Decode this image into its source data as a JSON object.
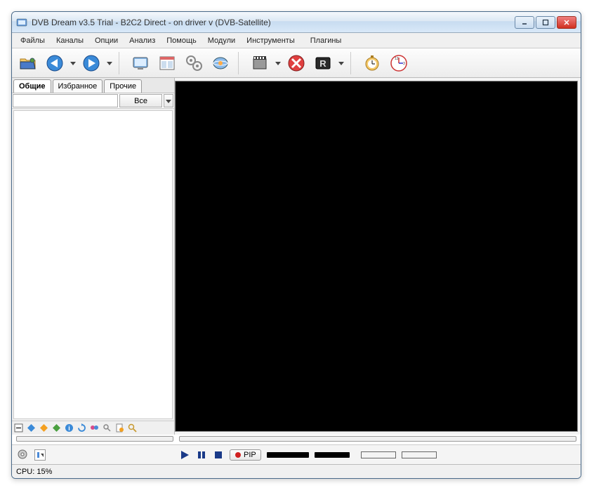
{
  "window": {
    "title": "DVB Dream v3.5 Trial - B2C2 Direct - on driver v (DVB-Satellite)"
  },
  "menu": {
    "files": "Файлы",
    "channels": "Каналы",
    "options": "Опции",
    "analyze": "Анализ",
    "help": "Помощь",
    "modules": "Модули",
    "tools": "Инструменты",
    "plugins": "Плагины"
  },
  "tabs": {
    "general": "Общие",
    "favorites": "Избранное",
    "others": "Прочие"
  },
  "filter": {
    "value": "",
    "all_label": "Все"
  },
  "controls": {
    "pip_label": "PIP"
  },
  "status": {
    "cpu": "CPU: 15%"
  }
}
